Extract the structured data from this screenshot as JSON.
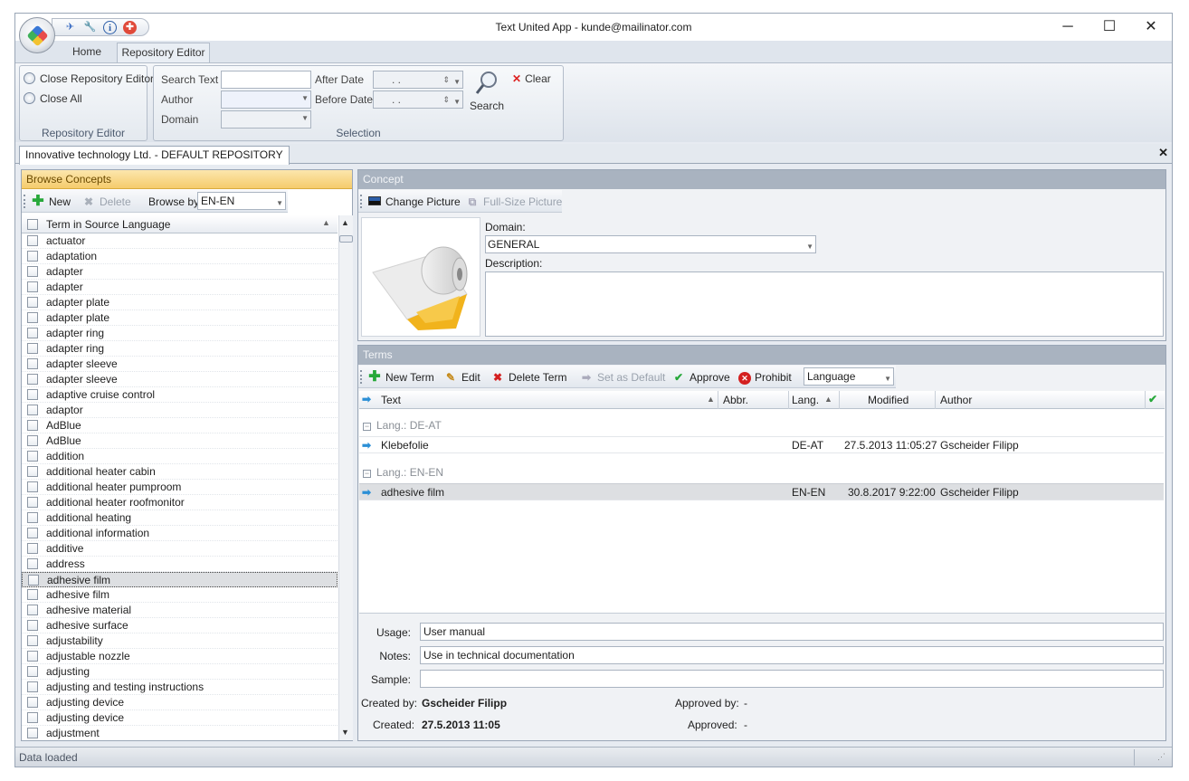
{
  "window": {
    "title": "Text United App - kunde@mailinator.com",
    "minimize_glyph": "─",
    "maximize_glyph": "☐",
    "close_glyph": "✕"
  },
  "quick_access": {
    "icons": [
      "rocket-icon",
      "wrench-icon",
      "info-icon",
      "help-lifebuoy-icon"
    ],
    "glyphs": [
      "✈",
      "🔧",
      "i",
      "✚"
    ]
  },
  "ribbon_tabs": [
    "Home",
    "Repository Editor"
  ],
  "ribbon": {
    "repo_group": {
      "label": "Repository Editor",
      "close_repo": "Close Repository Editor",
      "close_all": "Close All"
    },
    "selection_group": {
      "label": "Selection",
      "search_text_label": "Search Text",
      "search_text_value": "",
      "author_label": "Author",
      "author_value": "",
      "domain_label": "Domain",
      "domain_value": "",
      "after_date_label": "After Date",
      "after_date_value": ". .",
      "before_date_label": "Before Date",
      "before_date_value": ". .",
      "search_button": "Search",
      "clear_button": "Clear"
    }
  },
  "document_tab": {
    "label": "Innovative technology Ltd. - DEFAULT REPOSITORY",
    "close_glyph": "✕"
  },
  "browse": {
    "header": "Browse Concepts",
    "new_button": "New",
    "delete_button": "Delete",
    "browse_by_label": "Browse by",
    "browse_by_value": "EN-EN",
    "column_header": "Term in Source Language",
    "selected_index": 22,
    "items": [
      "actuator",
      "adaptation",
      "adapter",
      "adapter",
      "adapter plate",
      "adapter plate",
      "adapter ring",
      "adapter ring",
      "adapter sleeve",
      "adapter sleeve",
      "adaptive cruise control",
      "adaptor",
      "AdBlue",
      "AdBlue",
      "addition",
      "additional heater cabin",
      "additional heater pumproom",
      "additional heater roofmonitor",
      "additional heating",
      "additional information",
      "additive",
      "address",
      "adhesive film",
      "adhesive film",
      "adhesive material",
      "adhesive surface",
      "adjustability",
      "adjustable nozzle",
      "adjusting",
      "adjusting and testing instructions",
      "adjusting device",
      "adjusting device",
      "adjustment"
    ]
  },
  "concept": {
    "header": "Concept",
    "change_picture": "Change Picture",
    "full_size_picture": "Full-Size Picture",
    "domain_label": "Domain:",
    "domain_value": "GENERAL",
    "description_label": "Description:",
    "description_value": ""
  },
  "terms": {
    "header": "Terms",
    "new_term": "New Term",
    "edit": "Edit",
    "delete_term": "Delete Term",
    "set_default": "Set as Default",
    "approve": "Approve",
    "prohibit": "Prohibit",
    "language_filter": "Language",
    "columns": {
      "text": "Text",
      "abbr": "Abbr.",
      "lang": "Lang.",
      "modified": "Modified",
      "author": "Author"
    },
    "groups": [
      {
        "label": "Lang.:",
        "value": "DE-AT",
        "rows": [
          {
            "text": "Klebefolie",
            "abbr": "",
            "lang": "DE-AT",
            "modified": "27.5.2013 11:05:27",
            "author": "Gscheider Filipp"
          }
        ]
      },
      {
        "label": "Lang.:",
        "value": "EN-EN",
        "rows": [
          {
            "text": "adhesive film",
            "abbr": "",
            "lang": "EN-EN",
            "modified": "30.8.2017 9:22:00",
            "author": "Gscheider Filipp"
          }
        ]
      }
    ]
  },
  "details": {
    "usage_label": "Usage:",
    "usage_value": "User manual",
    "notes_label": "Notes:",
    "notes_value": "Use in technical documentation",
    "sample_label": "Sample:",
    "sample_value": "",
    "created_by_label": "Created by:",
    "created_by_value": "Gscheider Filipp",
    "created_label": "Created:",
    "created_value": "27.5.2013 11:05",
    "approved_by_label": "Approved by:",
    "approved_by_value": "-",
    "approved_label": "Approved:",
    "approved_value": "-"
  },
  "status": {
    "text": "Data loaded"
  },
  "colors": {
    "accent_header": "#f5cc6c",
    "selection": "#dddfe2",
    "arrow": "#2b8fd6"
  }
}
